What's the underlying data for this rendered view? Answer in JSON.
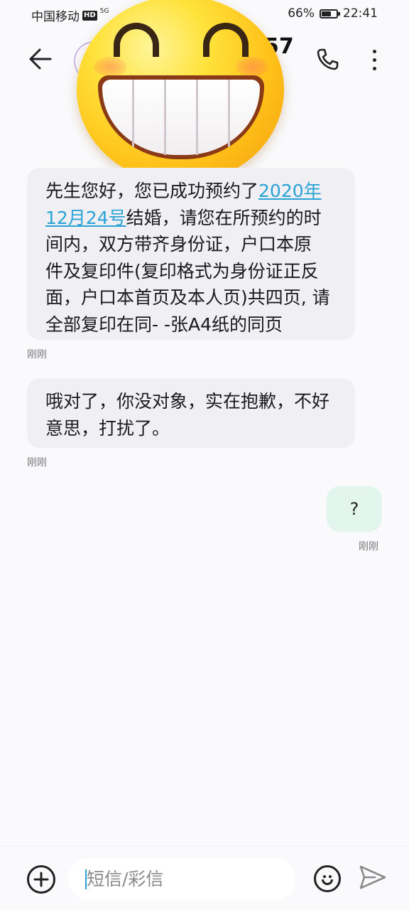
{
  "status_bar": {
    "carrier": "中国移动",
    "hd_label": "HD",
    "network": "5G",
    "battery": "66%",
    "battery_level": 0.66,
    "time": "22:41"
  },
  "header": {
    "title_visible": "57"
  },
  "messages": [
    {
      "direction": "incoming",
      "lines": [
        [
          "先生您好，您已成功预约了",
          "2020年"
        ],
        [
          "12月24号",
          "结婚，请您在所预约的时"
        ],
        [
          "间内，双方带齐身份证，户口本原"
        ],
        [
          "件及复印件(复印格式为身份证正反"
        ],
        [
          "面，户口本首页及本人页)共四页, 请"
        ],
        [
          "全部复印在同- -张A4纸的同页"
        ]
      ],
      "time": "刚刚"
    },
    {
      "direction": "incoming",
      "lines": [
        [
          "哦对了，你没对象，实在抱歉，不好"
        ],
        [
          "意思，打扰了。"
        ]
      ],
      "time": "刚刚"
    },
    {
      "direction": "outgoing",
      "text": "?",
      "time": "刚刚"
    }
  ],
  "input_bar": {
    "placeholder": "短信/彩信"
  },
  "icons": {
    "back": "back-arrow-icon",
    "call": "phone-icon",
    "more": "more-vertical-icon",
    "add": "add-circle-icon",
    "emoji": "emoji-icon",
    "send": "send-icon"
  },
  "colors": {
    "link": "#2aa3d6",
    "incoming_bubble": "#efeff4",
    "outgoing_bubble": "#e3f6ee"
  }
}
